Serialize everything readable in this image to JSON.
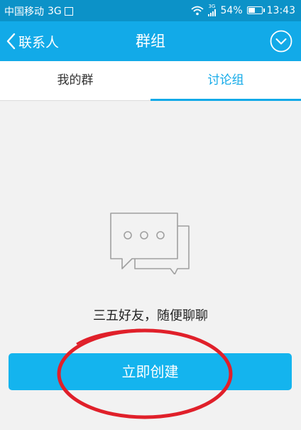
{
  "status_bar": {
    "carrier": "中国移动",
    "network": "3G",
    "signal_badge_top": "3G",
    "battery_percent": "54%",
    "battery_level": 0.54,
    "time": "13:43"
  },
  "nav": {
    "back_label": "联系人",
    "title": "群组"
  },
  "tabs": [
    {
      "label": "我的群",
      "active": false
    },
    {
      "label": "讨论组",
      "active": true
    }
  ],
  "empty_state": {
    "message": "三五好友，随便聊聊"
  },
  "create_button": {
    "label": "立即创建"
  },
  "colors": {
    "status_bar_bg": "#0c92c8",
    "nav_bg": "#12aae8",
    "accent": "#12aae8",
    "button_bg": "#14b4ee",
    "annotation_red": "#e0202a"
  }
}
